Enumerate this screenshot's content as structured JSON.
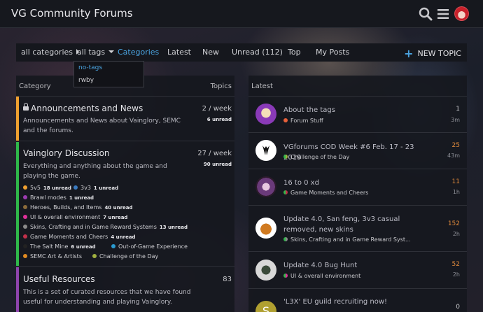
{
  "header": {
    "site_title": "VG Community Forums"
  },
  "nav": {
    "all_categories": "all categories",
    "all_tags": "all tags",
    "items": [
      "Categories",
      "Latest",
      "New",
      "Unread (112)",
      "Top",
      "My Posts"
    ],
    "new_topic": "NEW TOPIC"
  },
  "tags_dropdown": {
    "options": [
      "no-tags",
      "rwby"
    ]
  },
  "categories": {
    "header_category": "Category",
    "header_topics": "Topics",
    "rows": [
      {
        "title": "Announcements and News",
        "desc": "Announcements and News about Vainglory, SEMC and the forums.",
        "stat": "2 / week",
        "unread": "6 unread",
        "color": "#f0a030"
      },
      {
        "title": "Vainglory Discussion",
        "desc": "Everything and anything about the game and playing the game.",
        "stat": "27 / week",
        "unread": "90 unread",
        "color": "#2fb84a"
      },
      {
        "title": "Useful Resources",
        "desc": "This is a set of curated resources that we have found useful for understanding and playing Vainglory.",
        "stat": "83",
        "color": "#8e44ad"
      }
    ],
    "subcategories": [
      {
        "label": "5v5",
        "count": "18 unread",
        "color": "#f0a030"
      },
      {
        "label": "3v3",
        "count": "1 unread",
        "color": "#3a7ac0"
      },
      {
        "label": "Brawl modes",
        "count": "1 unread",
        "color": "#9b3bb0"
      },
      {
        "label": "Heroes, Builds, and Items",
        "count": "40 unread",
        "color": "#8a6a3a"
      },
      {
        "label": "UI & overall environment",
        "count": "7 unread",
        "color": "#e0309a"
      },
      {
        "label": "Skins, Crafting and in Game Reward Systems",
        "count": "13 unread",
        "color": "#8a8a8a"
      },
      {
        "label": "Game Moments and Cheers",
        "count": "4 unread",
        "color": "#c0304a"
      },
      {
        "label": "The Salt Mine",
        "count": "6 unread",
        "color": "#222222"
      },
      {
        "label": "Out-of-Game Experience",
        "count": "",
        "color": "#2a9ad0"
      },
      {
        "label": "SEMC Art & Artists",
        "count": "",
        "color": "#e08a20"
      },
      {
        "label": "Challenge of the Day",
        "count": "",
        "color": "#a0b040"
      }
    ]
  },
  "latest": {
    "header": "Latest",
    "topics": [
      {
        "title": "About the tags",
        "category": "Forum Stuff",
        "count": "1",
        "time": "3m",
        "cat_color": "#e8603a"
      },
      {
        "title": "VGforums COD Week #6 Feb. 17 - 23 2019",
        "category": "Challenge of the Day",
        "count": "25",
        "time": "43m",
        "cat_color": "#a0b040"
      },
      {
        "title": "16 to 0 xd",
        "category": "Game Moments and Cheers",
        "count": "11",
        "time": "1h",
        "cat_color": "#c0304a"
      },
      {
        "title": "Update 4.0, San feng, 3v3 casual removed, new skins",
        "category": "Skins, Crafting and in Game Reward Syst...",
        "count": "152",
        "time": "2h",
        "cat_color": "#8a8a8a"
      },
      {
        "title": "Update 4.0 Bug Hunt",
        "category": "UI & overall environment",
        "count": "52",
        "time": "2h",
        "cat_color": "#e0309a"
      },
      {
        "title": "'L3X' EU guild recruiting now!",
        "category": "",
        "count": "0",
        "time": "",
        "cat_color": "#c0a030"
      }
    ]
  }
}
